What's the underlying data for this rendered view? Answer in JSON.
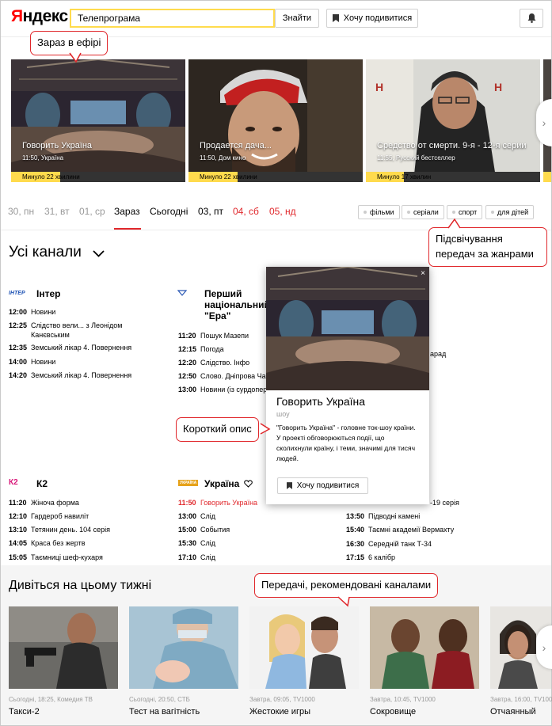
{
  "header": {
    "logo_red": "Я",
    "logo_black": "ндекс",
    "search_value": "Телепрограма",
    "find_label": "Знайти",
    "want_label": "Хочу подивитися"
  },
  "callouts": {
    "on_air": "Зараз в ефірі",
    "genres": "Підсвічування передач за жанрами",
    "short_desc": "Короткий опис",
    "recommended": "Передачі, рекомендовані каналами"
  },
  "on_air": [
    {
      "title": "Говорить Україна",
      "sub": "11:50, Україна",
      "elapsed": "Минуло 22 хвилини",
      "progress": 0.28
    },
    {
      "title": "Продается дача...",
      "sub": "11:50, Дом кино",
      "elapsed": "Минуло 22 хвилини",
      "progress": 0.28
    },
    {
      "title": "Средство от смерти. 9-я - 12-я серии",
      "sub": "11:55, Русский бестселлер",
      "elapsed": "Минуло 17 хвилин",
      "progress": 0.22
    }
  ],
  "days": [
    {
      "label": "30, пн",
      "style": "past"
    },
    {
      "label": "31, вт",
      "style": "past"
    },
    {
      "label": "01, ср",
      "style": "past"
    },
    {
      "label": "Зараз",
      "style": "active"
    },
    {
      "label": "Сьогодні",
      "style": "dark"
    },
    {
      "label": "03, пт",
      "style": "dark"
    },
    {
      "label": "04, сб",
      "style": "red"
    },
    {
      "label": "05, нд",
      "style": "red"
    }
  ],
  "genres": [
    "фільми",
    "серіали",
    "спорт",
    "для дітей"
  ],
  "all_channels": "Усі канали",
  "channels_row1": {
    "inter": {
      "logo": "ІНТЕР",
      "name": "Інтер",
      "programs": [
        {
          "time": "12:00",
          "name": "Новини"
        },
        {
          "time": "12:25",
          "name": "Слідство вели... з Леонідом Канєвським"
        },
        {
          "time": "12:35",
          "name": "Земський лікар 4. Повернення"
        },
        {
          "time": "14:00",
          "name": "Новини"
        },
        {
          "time": "14:20",
          "name": "Земський лікар 4. Повернення"
        }
      ]
    },
    "pershyi": {
      "name": "Перший національний \"Ера\"",
      "programs": [
        {
          "time": "11:20",
          "name": "Пошук Мазепи"
        },
        {
          "time": "12:15",
          "name": "Погода"
        },
        {
          "time": "12:20",
          "name": "Слідство. Інфо"
        },
        {
          "time": "12:50",
          "name": "Слово. Дніпрова Чайка"
        },
        {
          "time": "13:00",
          "name": "Новини (із сурдоперекладом)"
        }
      ]
    },
    "third_partial": "арад"
  },
  "channels_row2": {
    "k2": {
      "logo": "К2",
      "name": "К2",
      "programs": [
        {
          "time": "11:20",
          "name": "Жіноча форма"
        },
        {
          "time": "12:10",
          "name": "Гардероб навиліт"
        },
        {
          "time": "13:10",
          "name": "Тетянин день. 104 серія"
        },
        {
          "time": "14:05",
          "name": "Краса без жертв"
        },
        {
          "time": "15:05",
          "name": "Таємниці шеф-кухаря"
        }
      ]
    },
    "ukraina": {
      "logo": "УКРАЇНА",
      "name": "Україна",
      "programs": [
        {
          "time": "11:50",
          "name": "Говорить Україна",
          "current": true
        },
        {
          "time": "13:00",
          "name": "Слід"
        },
        {
          "time": "15:00",
          "name": "События"
        },
        {
          "time": "15:30",
          "name": "Слід"
        },
        {
          "time": "17:10",
          "name": "Слід"
        }
      ]
    },
    "third": {
      "first_partial": "-19 серія",
      "programs": [
        {
          "time": "13:50",
          "name": "Підводні камені"
        },
        {
          "time": "15:40",
          "name": "Таємні академії Вермахту"
        },
        {
          "time": "16:30",
          "name": "Середній танк Т-34"
        },
        {
          "time": "17:15",
          "name": "6 калібр"
        }
      ]
    }
  },
  "popup": {
    "title": "Говорить Україна",
    "genre": "шоу",
    "description": "\"Говорить Україна\" - головне ток-шоу країни. У проекті обговорюються події, що сколихнули країну, і теми, значимі для тисяч людей.",
    "button": "Хочу подивитися"
  },
  "week": {
    "title": "Дивіться на цьому тижні",
    "items": [
      {
        "meta": "Сьогодні, 18:25, Комедия ТВ",
        "title": "Такси-2"
      },
      {
        "meta": "Сьогодні, 20:50, СТБ",
        "title": "Тест на вагітність"
      },
      {
        "meta": "Завтра, 09:05, TV1000",
        "title": "Жестокие игры"
      },
      {
        "meta": "Завтра, 10:45, TV1000",
        "title": "Сокровище"
      },
      {
        "meta": "Завтра, 16:00, TV1000",
        "title": "Отчаянный"
      }
    ]
  },
  "colors": {
    "accent_red": "#e0272b",
    "search_yellow": "#ffdb4d"
  },
  "icons": [
    "bookmark-icon",
    "bell-icon",
    "chevron-down-icon",
    "chevron-right-icon",
    "heart-icon",
    "close-icon"
  ]
}
